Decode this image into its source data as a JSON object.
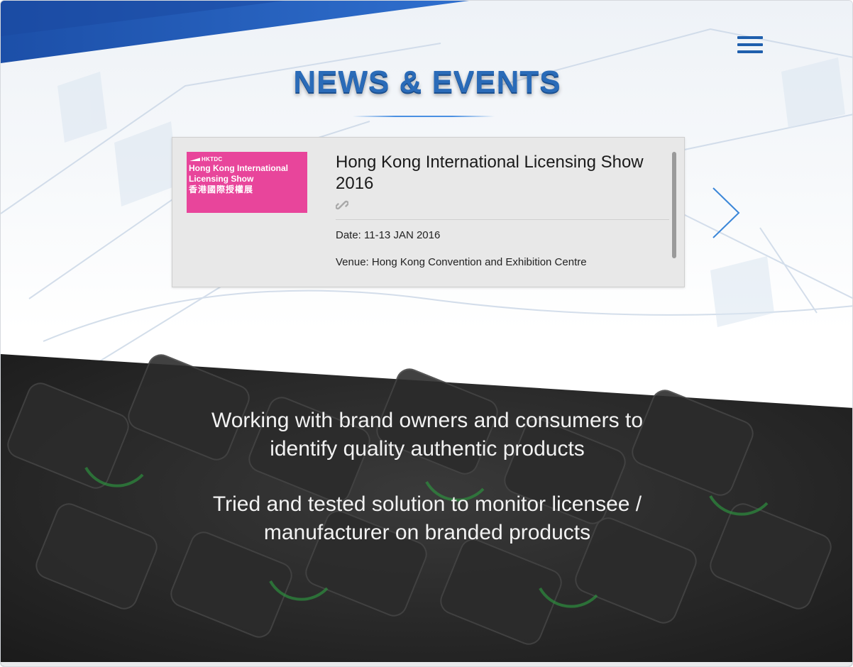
{
  "header": {
    "menu_icon": "hamburger-menu-icon"
  },
  "news_section": {
    "title": "NEWS & EVENTS",
    "items": [
      {
        "thumb": {
          "org": "HKTDC",
          "name_line1": "Hong Kong International",
          "name_line2": "Licensing Show",
          "name_cn": "香港國際授權展",
          "bg_color": "#e8459b"
        },
        "title": "Hong Kong International Licensing Show 2016",
        "link_icon": "link-icon",
        "date": "Date: 11-13 JAN 2016",
        "venue": "Venue: Hong Kong Convention and Exhibition Centre"
      }
    ],
    "next_icon": "chevron-right-icon"
  },
  "promo": {
    "line1_a": "Working with brand owners and consumers to",
    "line1_b": "identify quality authentic products",
    "line2_a": "Tried and tested solution to monitor licensee /",
    "line2_b": "manufacturer on branded products"
  },
  "colors": {
    "brand_blue": "#1f5fad",
    "title_blue": "#2a6bb8",
    "dark_band": "#262626"
  }
}
